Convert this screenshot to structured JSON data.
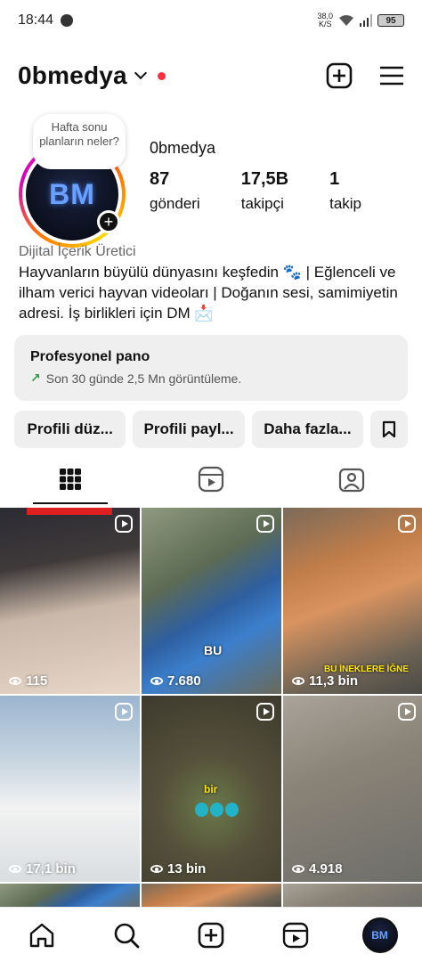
{
  "status": {
    "time": "18:44",
    "speed_value": "38,0",
    "speed_unit": "K/S",
    "battery": "95"
  },
  "header": {
    "username": "0bmedya"
  },
  "profile": {
    "note": "Hafta sonu planların neler?",
    "avatar_text": "BM",
    "name": "0bmedya",
    "stats": [
      {
        "value": "87",
        "label": "gönderi"
      },
      {
        "value": "17,5B",
        "label": "takipçi"
      },
      {
        "value": "1",
        "label": "takip"
      }
    ],
    "category": "Dijital İçerik Üretici",
    "bio": "Hayvanların büyülü dünyasını keşfedin 🐾 | Eğlenceli ve ilham verici hayvan videoları | Doğanın sesi, samimiyetin adresi. İş birlikleri için DM 📩"
  },
  "pro_dashboard": {
    "title": "Profesyonel pano",
    "subtitle": "Son 30 günde 2,5 Mn görüntüleme."
  },
  "buttons": {
    "edit": "Profili düz...",
    "share": "Profili payl...",
    "more": "Daha fazla..."
  },
  "grid": [
    {
      "views": "115",
      "overlay": ""
    },
    {
      "views": "7.680",
      "overlay": "BU"
    },
    {
      "views": "11,3 bin",
      "overlay": "BU İNEKLERE İĞNE"
    },
    {
      "views": "17,1 bin",
      "overlay": ""
    },
    {
      "views": "13 bin",
      "overlay": "bir"
    },
    {
      "views": "4.918",
      "overlay": ""
    }
  ],
  "nav": {
    "avatar_text": "BM"
  },
  "colors": {
    "accent_red": "#ff3040",
    "trend_green": "#2a9d4b"
  }
}
